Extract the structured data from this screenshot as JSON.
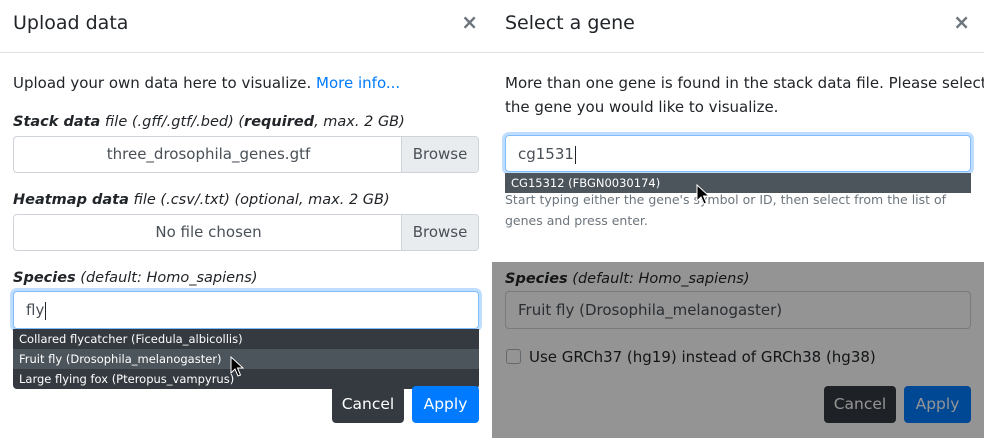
{
  "upload": {
    "title": "Upload data",
    "close": "×",
    "intro_text": "Upload your own data here to visualize.",
    "intro_link": "More info...",
    "stack": {
      "label_bold": "Stack data",
      "label_mid": " file (.gff/.gtf/.bed) (",
      "label_req": "required",
      "label_end": ", max. 2 GB)",
      "filename": "three_drosophila_genes.gtf",
      "browse": "Browse"
    },
    "heatmap": {
      "label_bold": "Heatmap data",
      "label_rest": " file (.csv/.txt) (optional, max. 2 GB)",
      "filename": "No file chosen",
      "browse": "Browse"
    },
    "species": {
      "label_bold": "Species",
      "label_rest": " (default: Homo_sapiens)",
      "value": "fly",
      "suggestions": [
        "Collared flycatcher (Ficedula_albicollis)",
        "Fruit fly (Drosophila_melanogaster)",
        "Large flying fox (Pteropus_vampyrus)"
      ],
      "highlighted_index": 1
    },
    "cancel": "Cancel",
    "apply": "Apply"
  },
  "gene": {
    "title": "Select a gene",
    "close": "×",
    "desc_line1": "More than one gene is found in the stack data file. Please select",
    "desc_line2": "the gene you would like to visualize.",
    "value": "cg1531",
    "suggestion": "CG15312 (FBGN0030174)",
    "help_line1": "Start typing either the gene's symbol or ID, then select from the list of",
    "help_line2": "genes and press enter.",
    "species": {
      "label_bold": "Species",
      "label_rest": " (default: Homo_sapiens)",
      "value": "Fruit fly (Drosophila_melanogaster)"
    },
    "checkbox_label": "Use GRCh37 (hg19) instead of GRCh38 (hg38)",
    "cancel": "Cancel",
    "apply": "Apply"
  },
  "colors": {
    "primary": "#007bff",
    "dark": "#343a40",
    "overlay": "rgba(0,0,0,0.42)"
  }
}
